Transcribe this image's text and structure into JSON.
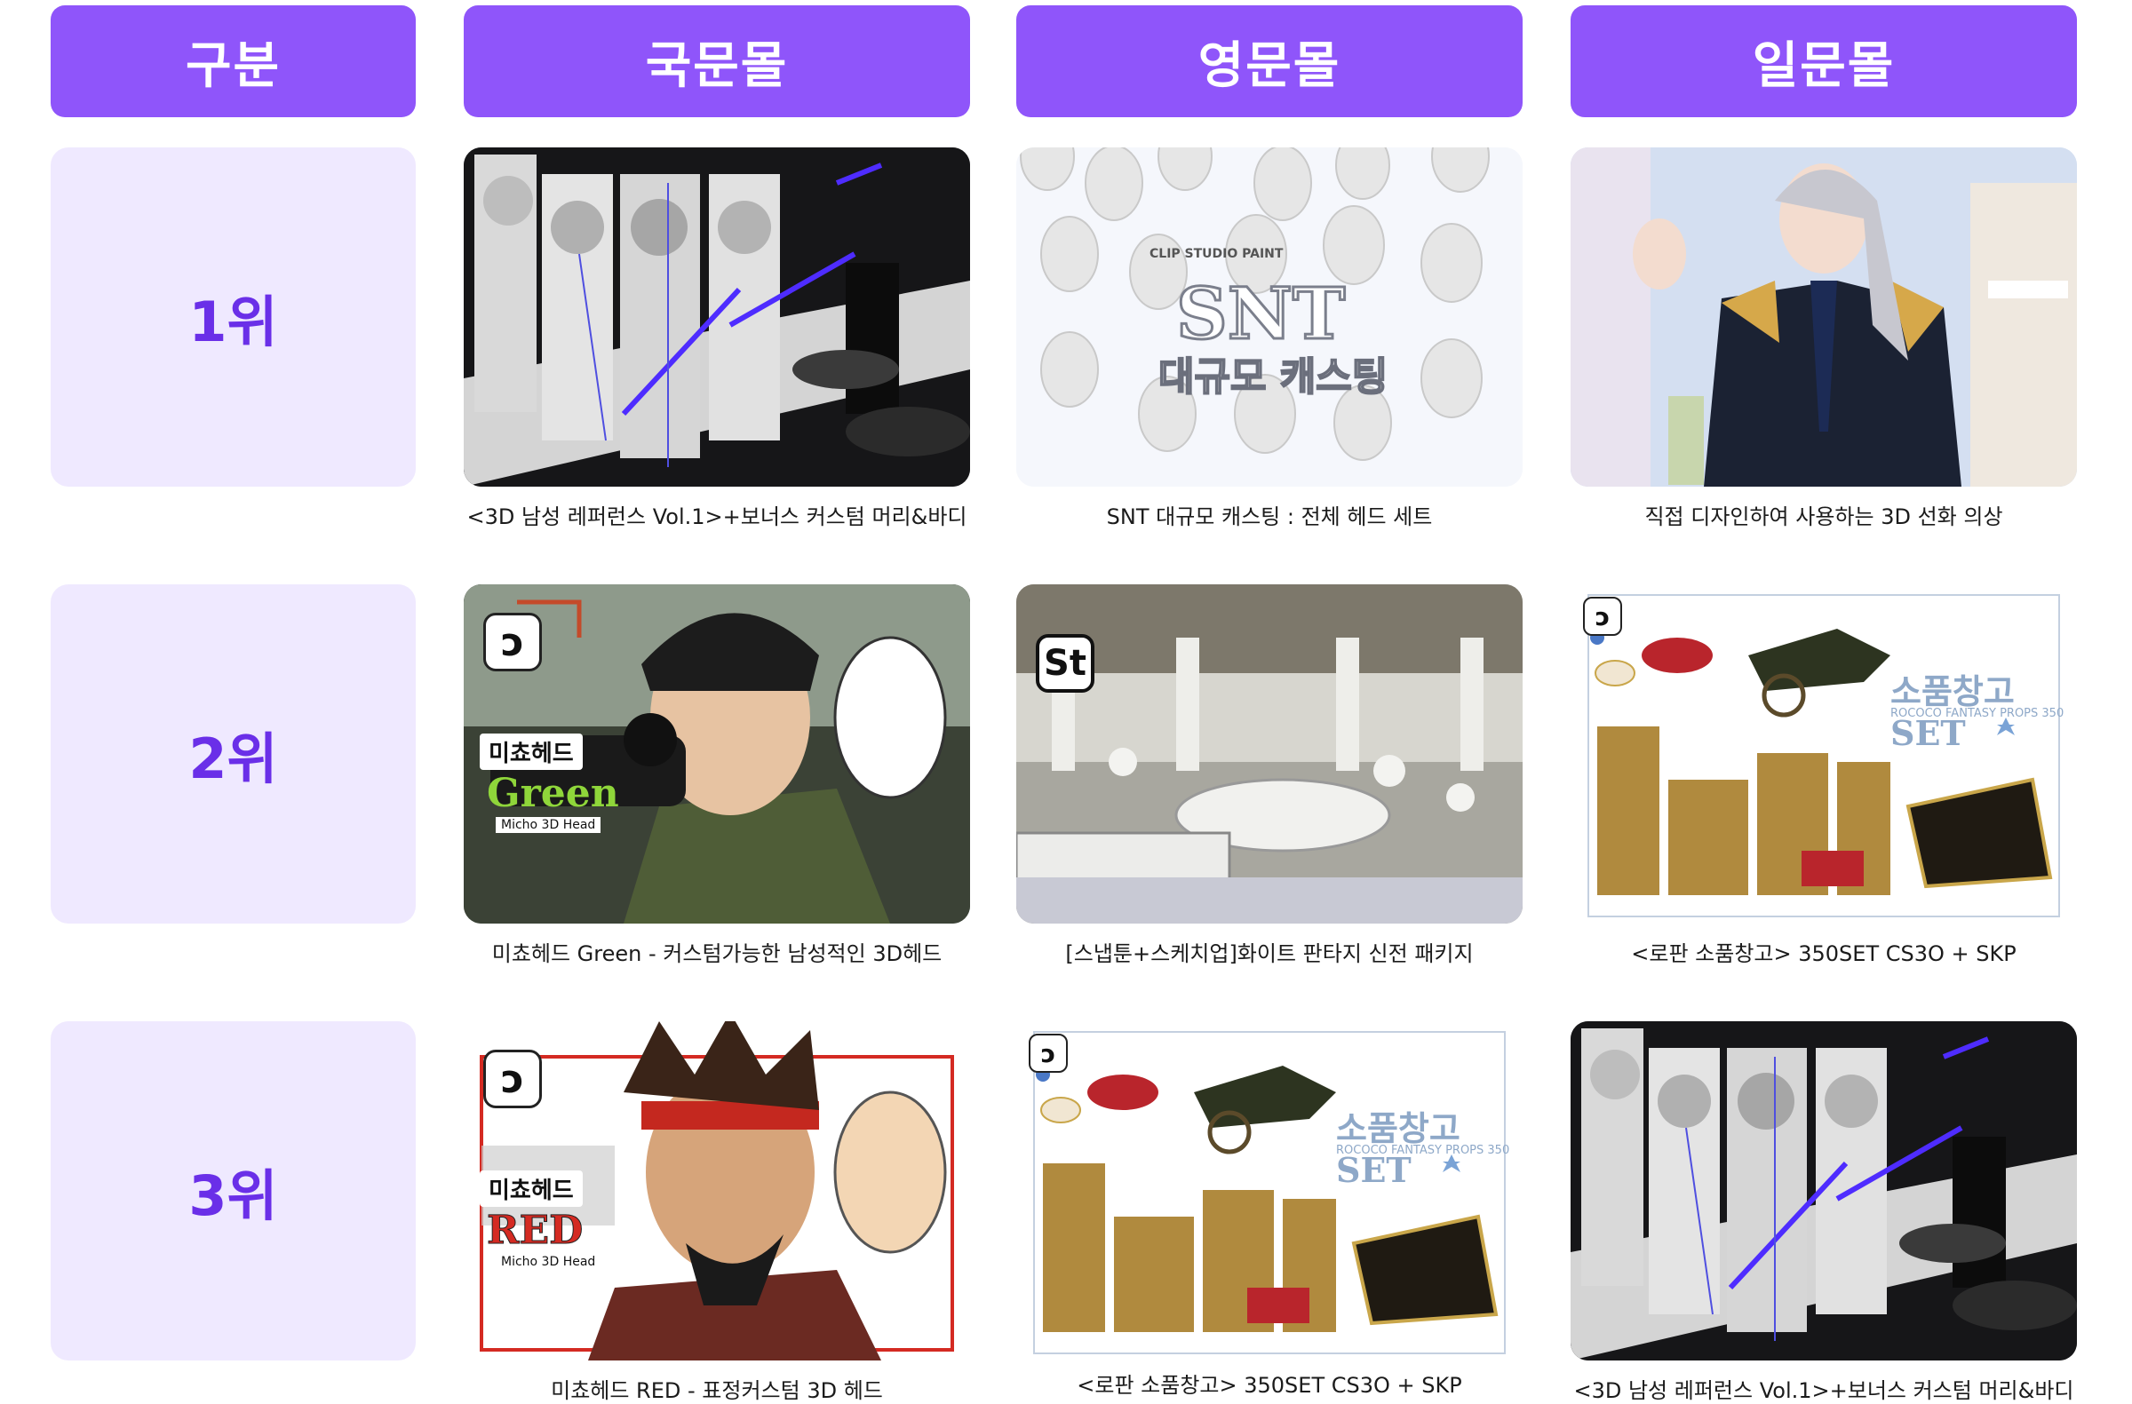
{
  "headers": [
    "구분",
    "국문몰",
    "영문몰",
    "일문몰"
  ],
  "rows": [
    {
      "rank": "1위",
      "items": [
        {
          "caption": "<3D 남성 레퍼런스 Vol.1>+보너스 커스텀 머리&바디"
        },
        {
          "caption": "SNT 대규모 캐스팅 : 전체 헤드 세트",
          "overlay_brand": "CLIP STUDIO PAINT",
          "overlay_title": "SNT",
          "overlay_sub": "대규모 캐스팅"
        },
        {
          "caption": "직접 디자인하여 사용하는 3D 선화 의상"
        }
      ]
    },
    {
      "rank": "2위",
      "items": [
        {
          "caption": "미쵸헤드 Green - 커스텀가능한 남성적인 3D헤드",
          "chip": "미쵸헤드",
          "word": "Green",
          "sub": "Micho 3D Head"
        },
        {
          "caption": "[스냅툰+스케치업]화이트 판타지 신전 패키지",
          "logo": "St"
        },
        {
          "caption": "<로판 소품창고> 350SET CS3O + SKP",
          "overlay_title": "소품창고SET",
          "overlay_sub": "ROCOCO FANTASY PROPS 350"
        }
      ]
    },
    {
      "rank": "3위",
      "items": [
        {
          "caption": "미쵸헤드 RED - 표정커스텀 3D 헤드",
          "chip": "미쵸헤드",
          "word": "RED",
          "sub": "Micho 3D Head"
        },
        {
          "caption": "<로판 소품창고> 350SET CS3O + SKP",
          "overlay_title": "소품창고SET",
          "overlay_sub": "ROCOCO FANTASY PROPS 350"
        },
        {
          "caption": "<3D 남성 레퍼런스 Vol.1>+보너스 커스텀 머리&바디"
        }
      ]
    }
  ],
  "colors": {
    "header_bg": "#8f55fa",
    "rank_bg": "#efe9ff",
    "rank_text": "#6a2fe8",
    "green_word": "#8fd63a",
    "red_word": "#d42a22"
  }
}
